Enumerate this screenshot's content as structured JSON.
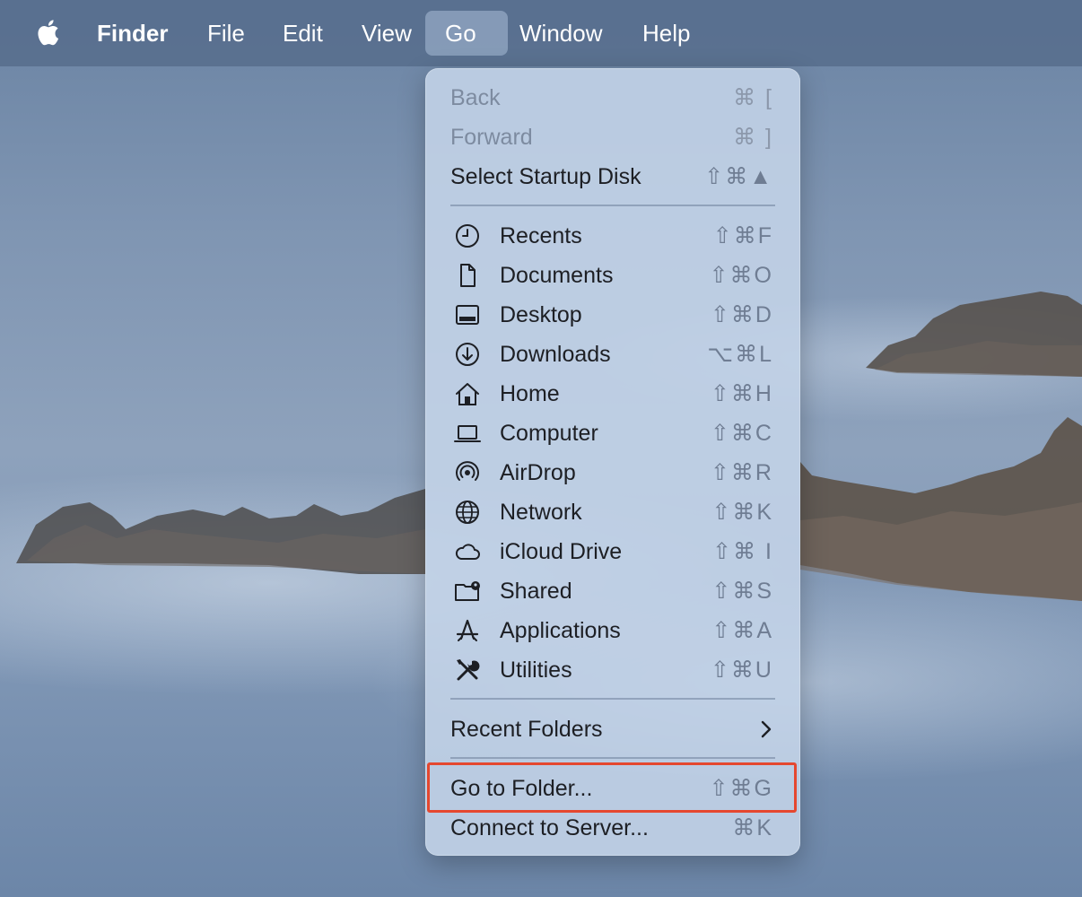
{
  "menubar": {
    "apple_icon": "apple-logo-icon",
    "items": [
      {
        "label": "Finder"
      },
      {
        "label": "File"
      },
      {
        "label": "Edit"
      },
      {
        "label": "View"
      },
      {
        "label": "Go"
      },
      {
        "label": "Window"
      },
      {
        "label": "Help"
      }
    ]
  },
  "go_menu": {
    "nav": [
      {
        "label": "Back",
        "shortcut": "⌘ [",
        "enabled": false
      },
      {
        "label": "Forward",
        "shortcut": "⌘ ]",
        "enabled": false
      },
      {
        "label": "Select Startup Disk",
        "shortcut": "⇧⌘▲",
        "enabled": true
      }
    ],
    "places": [
      {
        "label": "Recents",
        "shortcut": "⇧⌘F",
        "icon": "clock-icon"
      },
      {
        "label": "Documents",
        "shortcut": "⇧⌘O",
        "icon": "document-icon"
      },
      {
        "label": "Desktop",
        "shortcut": "⇧⌘D",
        "icon": "desktop-icon"
      },
      {
        "label": "Downloads",
        "shortcut": "⌥⌘L",
        "icon": "download-icon"
      },
      {
        "label": "Home",
        "shortcut": "⇧⌘H",
        "icon": "home-icon"
      },
      {
        "label": "Computer",
        "shortcut": "⇧⌘C",
        "icon": "laptop-icon"
      },
      {
        "label": "AirDrop",
        "shortcut": "⇧⌘R",
        "icon": "airdrop-icon"
      },
      {
        "label": "Network",
        "shortcut": "⇧⌘K",
        "icon": "globe-icon"
      },
      {
        "label": "iCloud Drive",
        "shortcut": "⇧⌘ I",
        "icon": "cloud-icon"
      },
      {
        "label": "Shared",
        "shortcut": "⇧⌘S",
        "icon": "shared-folder-icon"
      },
      {
        "label": "Applications",
        "shortcut": "⇧⌘A",
        "icon": "applications-icon"
      },
      {
        "label": "Utilities",
        "shortcut": "⇧⌘U",
        "icon": "utilities-icon"
      }
    ],
    "recent_folders": {
      "label": "Recent Folders",
      "icon": "chevron-right-icon"
    },
    "go_to_folder": {
      "label": "Go to Folder...",
      "shortcut": "⇧⌘G"
    },
    "connect_to_server": {
      "label": "Connect to Server...",
      "shortcut": "⌘K"
    }
  },
  "annotation": {
    "color": "#e5472f"
  }
}
